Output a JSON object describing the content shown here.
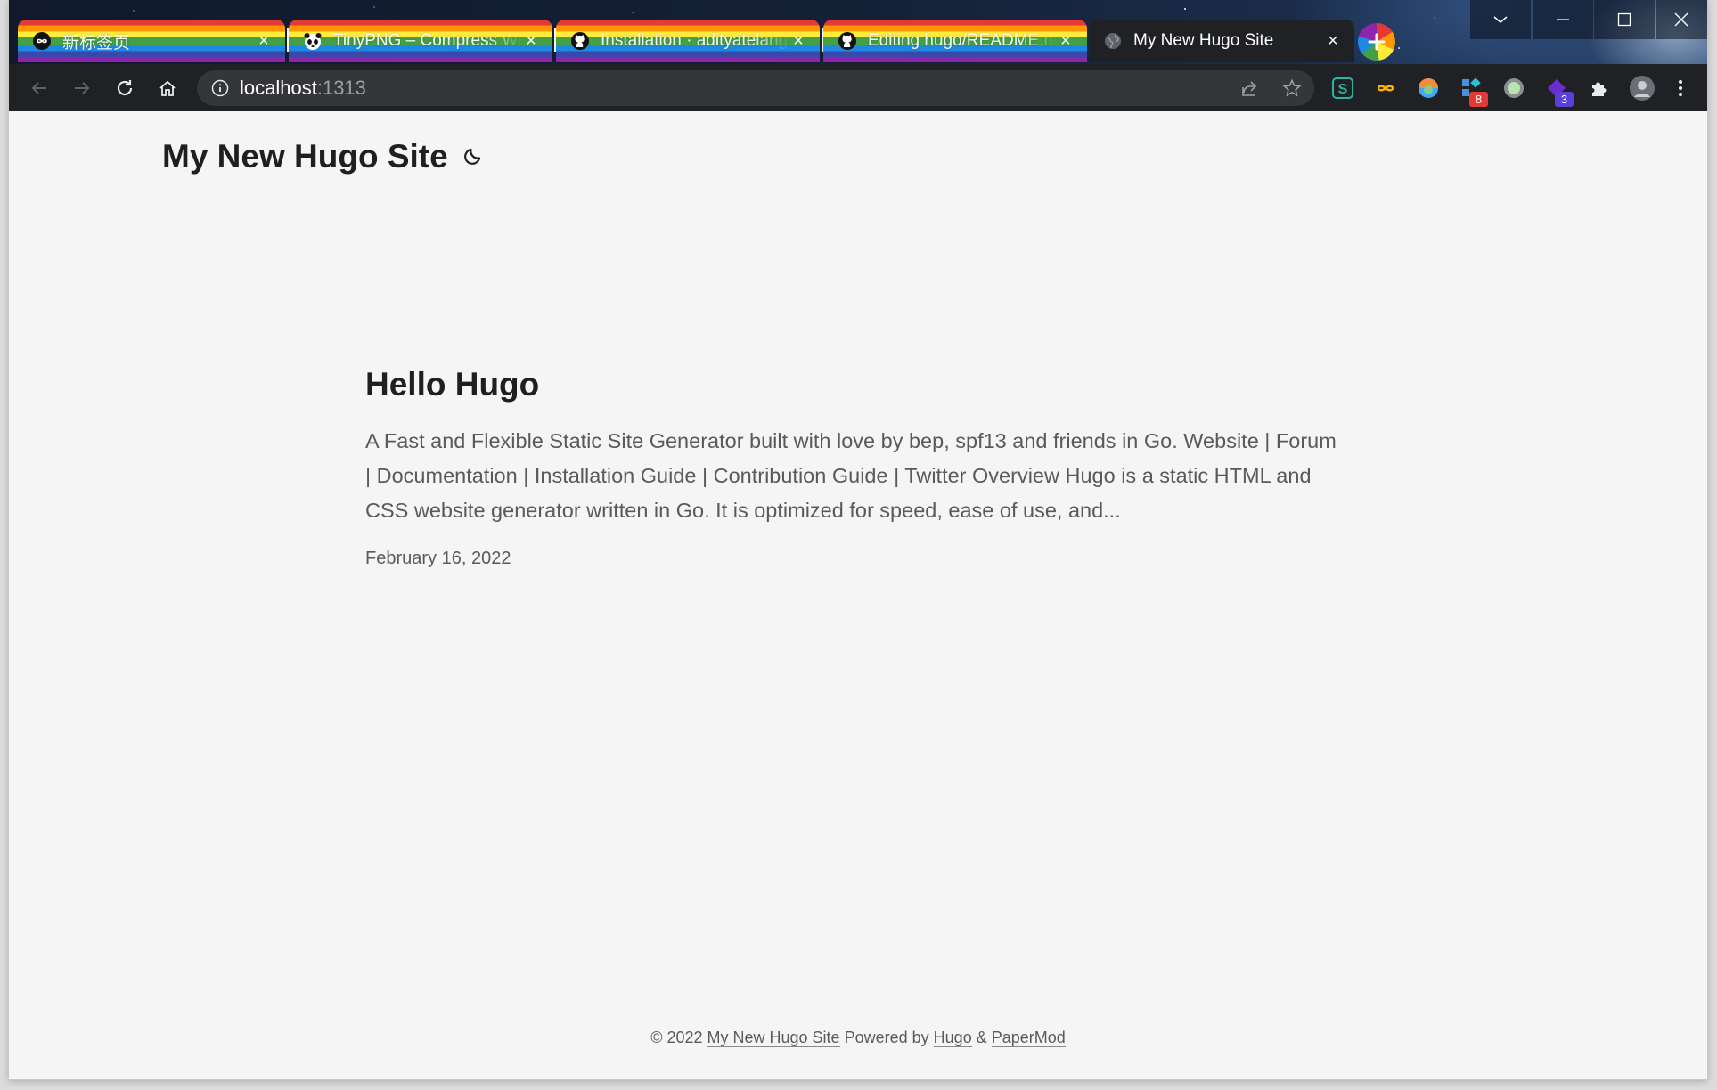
{
  "browser": {
    "tabs": [
      {
        "title": "新标签页",
        "favicon": "infinity-icon"
      },
      {
        "title": "TinyPNG – Compress WebP, PNG and JPEG",
        "favicon": "panda-icon"
      },
      {
        "title": "Installation · adityatelange/hugo-PaperMod",
        "favicon": "github-icon"
      },
      {
        "title": "Editing hugo/README.md",
        "favicon": "github-icon"
      },
      {
        "title": "My New Hugo Site",
        "favicon": "globe-icon"
      }
    ],
    "url_host": "localhost",
    "url_port": ":1313",
    "extension_badges": [
      "8",
      "3"
    ],
    "colors": {
      "toolbar": "#202124",
      "omnibox": "#35363a",
      "page_bg": "#f5f5f5"
    }
  },
  "site": {
    "title": "My New Hugo Site"
  },
  "post": {
    "title": "Hello Hugo",
    "summary": "A Fast and Flexible Static Site Generator built with love by bep, spf13 and friends in Go. Website | Forum | Documentation | Installation Guide | Contribution Guide | Twitter Overview Hugo is a static HTML and CSS website generator written in Go. It is optimized for speed, ease of use, and...",
    "date": "February 16, 2022"
  },
  "footer": {
    "copyright": "© 2022",
    "site_link": "My New Hugo Site",
    "powered_by": "Powered by",
    "hugo_link": "Hugo",
    "amp": "&",
    "theme_link": "PaperMod"
  }
}
